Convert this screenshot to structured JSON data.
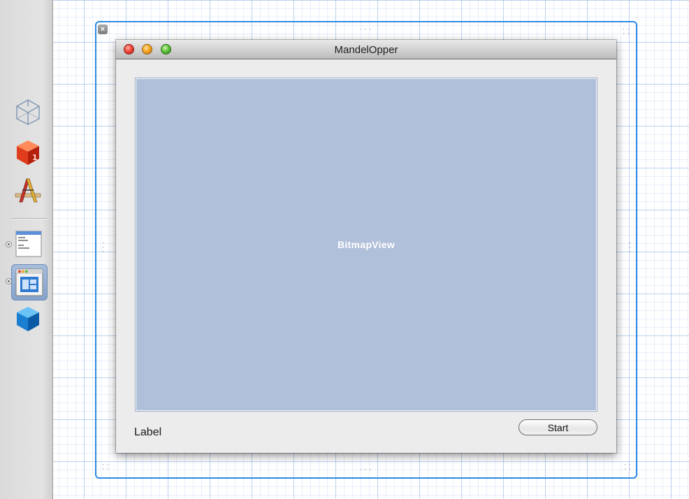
{
  "window": {
    "title": "MandelOpper",
    "bitmap_view_label": "BitmapView",
    "label_text": "Label",
    "start_button": "Start",
    "close_glyph": "×"
  },
  "sidebar": {
    "items": [
      {
        "icon": "object-cube-icon"
      },
      {
        "icon": "first-responder-cube-icon"
      },
      {
        "icon": "application-icon"
      },
      {
        "icon": "main-menu-icon",
        "menu_lines": [
          "New",
          "Open...",
          "Save",
          "Save As..."
        ]
      },
      {
        "icon": "window-icon",
        "selected": true
      },
      {
        "icon": "app-delegate-cube-icon"
      }
    ]
  },
  "colors": {
    "selection_frame": "#2c8ae6",
    "bitmap_view_fill": "#b0bfda",
    "grid_line": "#a9c2e8"
  }
}
